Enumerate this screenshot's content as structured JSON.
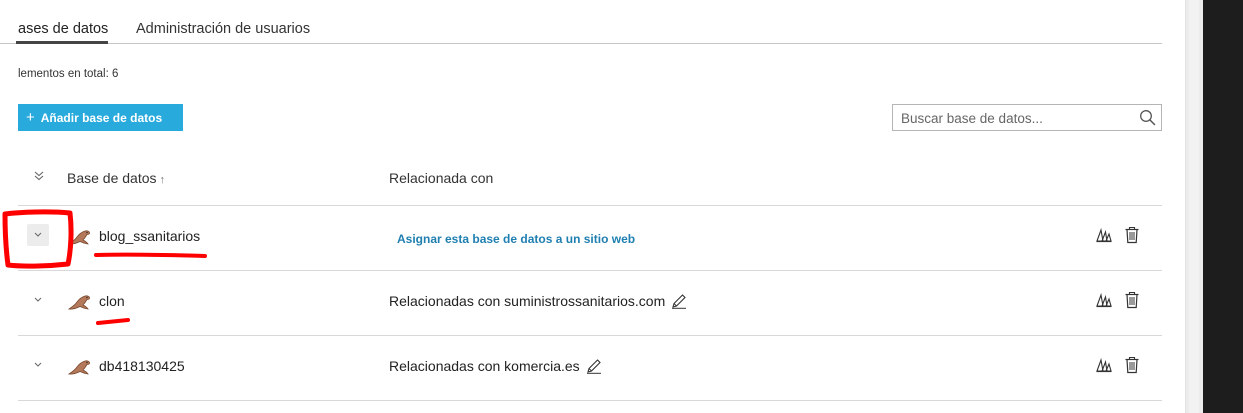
{
  "tabs": [
    {
      "label": "ases de datos",
      "active": true
    },
    {
      "label": "Administración de usuarios",
      "active": false
    }
  ],
  "total_text": "lementos en total: 6",
  "toolbar": {
    "add_label": "Añadir base de datos",
    "search_placeholder": "Buscar base de datos..."
  },
  "table": {
    "col_database": "Base de datos",
    "col_sort_indicator": "↑",
    "col_related": "Relacionada con",
    "rows": [
      {
        "name": "blog_ssanitarios",
        "relation": "Asignar esta base de datos a un sitio web",
        "relation_is_link": true,
        "icon": "mysql-seal-icon"
      },
      {
        "name": "clon",
        "relation": "Relacionadas con suministrossanitarios.com",
        "relation_is_link": false,
        "icon": "mysql-seal-icon"
      },
      {
        "name": "db418130425",
        "relation": "Relacionadas con komercia.es",
        "relation_is_link": false,
        "icon": "mysql-seal-icon"
      }
    ]
  },
  "colors": {
    "accent": "#28aadc",
    "link": "#1f7fb0",
    "annotation": "#ff0000"
  }
}
